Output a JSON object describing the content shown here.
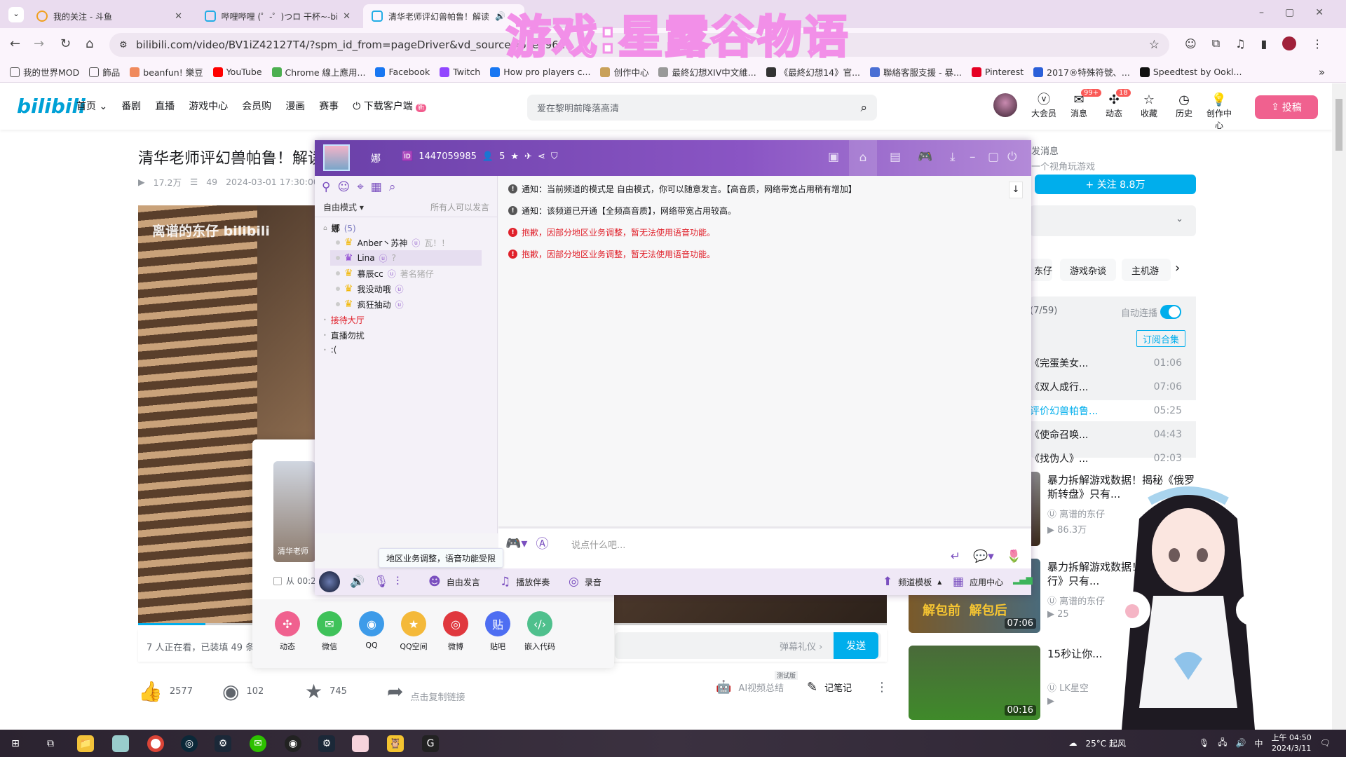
{
  "browser": {
    "tabs": [
      {
        "title": "我的关注 - 斗鱼"
      },
      {
        "title": "哔哩哔哩 (゜-゜)つロ 干杯~-bili"
      },
      {
        "title": "清华老师评幻兽帕鲁！解读"
      }
    ],
    "url": "bilibili.com/video/BV1iZ42127T4/?spm_id_from=pageDriver&vd_source=6ced96...",
    "bookmarks": [
      "我的世界MOD",
      "飾品",
      "beanfun! 樂豆",
      "YouTube",
      "Chrome 線上應用...",
      "Facebook",
      "Twitch",
      "How pro players c...",
      "创作中心",
      "最終幻想XIV中文維...",
      "《最終幻想14》官...",
      "聯絡客服支援 - 暴...",
      "Pinterest",
      "2017®特殊符號、...",
      "Speedtest by Ookl..."
    ],
    "more_bookmarks": "»"
  },
  "overlay_watermark": "游戏:星露谷物语",
  "bili": {
    "logo": "bilibili",
    "nav": [
      "首页",
      "番剧",
      "直播",
      "游戏中心",
      "会员购",
      "漫画",
      "赛事",
      "下载客户端"
    ],
    "nav_new_badge": "新",
    "search_placeholder": "爱在黎明前降落高清",
    "header_icons": [
      {
        "label": "大会员",
        "icon": "vip-icon"
      },
      {
        "label": "消息",
        "icon": "message-icon",
        "badge": "99+"
      },
      {
        "label": "动态",
        "icon": "dynamic-icon",
        "badge": "18"
      },
      {
        "label": "收藏",
        "icon": "star-icon"
      },
      {
        "label": "历史",
        "icon": "clock-icon"
      },
      {
        "label": "创作中心",
        "icon": "bulb-icon"
      }
    ],
    "upload": "投稿",
    "accent": "#00aeec",
    "pink": "#f0618f"
  },
  "video": {
    "title": "清华老师评幻兽帕鲁！解读",
    "views": "17.2万",
    "danmaku_count": "49",
    "date": "2024-03-01 17:30:00",
    "player_watermark": "离谱的东仔 bilibili",
    "progress_percent": 9,
    "watching": "7 人正在看，已装填 49 条弹幕",
    "danmaku_etiquette": "弹幕礼仪 ›",
    "send": "发送",
    "likes": "2577",
    "coins": "102",
    "favorites": "745",
    "share_hint": "点击复制链接",
    "ai_beta": "测试版",
    "ai_summary": "AI视频总结",
    "notes": "记笔记"
  },
  "share": {
    "thumb_caption": "清华老师",
    "from_time": "从 00:2",
    "targets": [
      {
        "label": "动态",
        "color": "#f0618f",
        "g": "✣"
      },
      {
        "label": "微信",
        "color": "#3fc25a",
        "g": "✉"
      },
      {
        "label": "QQ",
        "color": "#3d9be9",
        "g": "◉"
      },
      {
        "label": "QQ空间",
        "color": "#f4b93a",
        "g": "★"
      },
      {
        "label": "微博",
        "color": "#e0383e",
        "g": "◎"
      },
      {
        "label": "贴吧",
        "color": "#4e6ef2",
        "g": "贴"
      },
      {
        "label": "嵌入代码",
        "color": "#4fc08d",
        "g": "‹/›"
      }
    ]
  },
  "right": {
    "msg": "发消息",
    "sign": "一个视角玩游戏",
    "follow": "+ 关注 8.8万",
    "tags": [
      "东仔",
      "游戏杂谈",
      "主机游"
    ],
    "playlist_count": "(7/59)",
    "autoplay": "自动连播",
    "autoplay_on": true,
    "subscribe": "订阅合集",
    "playlist": [
      {
        "t": "《完蛋美女...",
        "d": "01:06"
      },
      {
        "t": "《双人成行...",
        "d": "07:06"
      },
      {
        "t": "评价幻兽帕鲁...",
        "d": "05:25",
        "current": true
      },
      {
        "t": "《使命召唤...",
        "d": "04:43"
      },
      {
        "t": "《找伪人》...",
        "d": "02:03"
      }
    ],
    "recs": [
      {
        "title": "暴力拆解游戏数据！揭秘《俄罗斯转盘》只有...",
        "up": "离谱的东仔",
        "views": "86.3万",
        "dur": ""
      },
      {
        "title": "暴力拆解游戏数据！《双人成行》只有...",
        "up": "离谱的东仔",
        "views": "25",
        "dur": "07:06",
        "thumb_text": "解包前  解包后"
      },
      {
        "title": "15秒让你...",
        "up": "LK星空",
        "views": "",
        "dur": "00:16"
      }
    ]
  },
  "yy": {
    "channel_name": "娜",
    "id": "1447059985",
    "online": "5",
    "mode": "自由模式",
    "mode_desc": "所有人可以发言",
    "channel_root": "娜",
    "channel_root_count": "(5)",
    "users": [
      {
        "name": "Anber丶苏神",
        "sign": "瓦！！"
      },
      {
        "name": "Lina",
        "sign": "?"
      },
      {
        "name": "慕辰cc",
        "sign": "著名猪仔"
      },
      {
        "name": "我没动哦",
        "sign": ""
      },
      {
        "name": "疯狂抽动",
        "sign": ""
      }
    ],
    "subchannels": [
      "接待大厅",
      "直播勿扰",
      ":("
    ],
    "messages": [
      {
        "text": "通知：当前频道的模式是 自由模式，你可以随意发言。【高音质，网络带宽占用稍有增加】",
        "type": "info"
      },
      {
        "text": "通知：该频道已开通【全频高音质】，网络带宽占用较高。",
        "type": "info"
      },
      {
        "text": "抱歉，因部分地区业务调整，暂无法使用语音功能。",
        "type": "error"
      },
      {
        "text": "抱歉，因部分地区业务调整，暂无法使用语音功能。",
        "type": "error"
      }
    ],
    "input_placeholder": "说点什么吧...",
    "tooltip": "地区业务调整，语音功能受限",
    "bar": {
      "free_speak": "自由发言",
      "accompany": "播放伴奏",
      "record": "录音",
      "template": "频道模板",
      "apps": "应用中心"
    },
    "accent": "#7a4fbf",
    "error_color": "#e0202a"
  },
  "taskbar": {
    "weather": "25°C 起风",
    "time": "上午 04:50",
    "date": "2024/3/11",
    "ime": "中"
  }
}
